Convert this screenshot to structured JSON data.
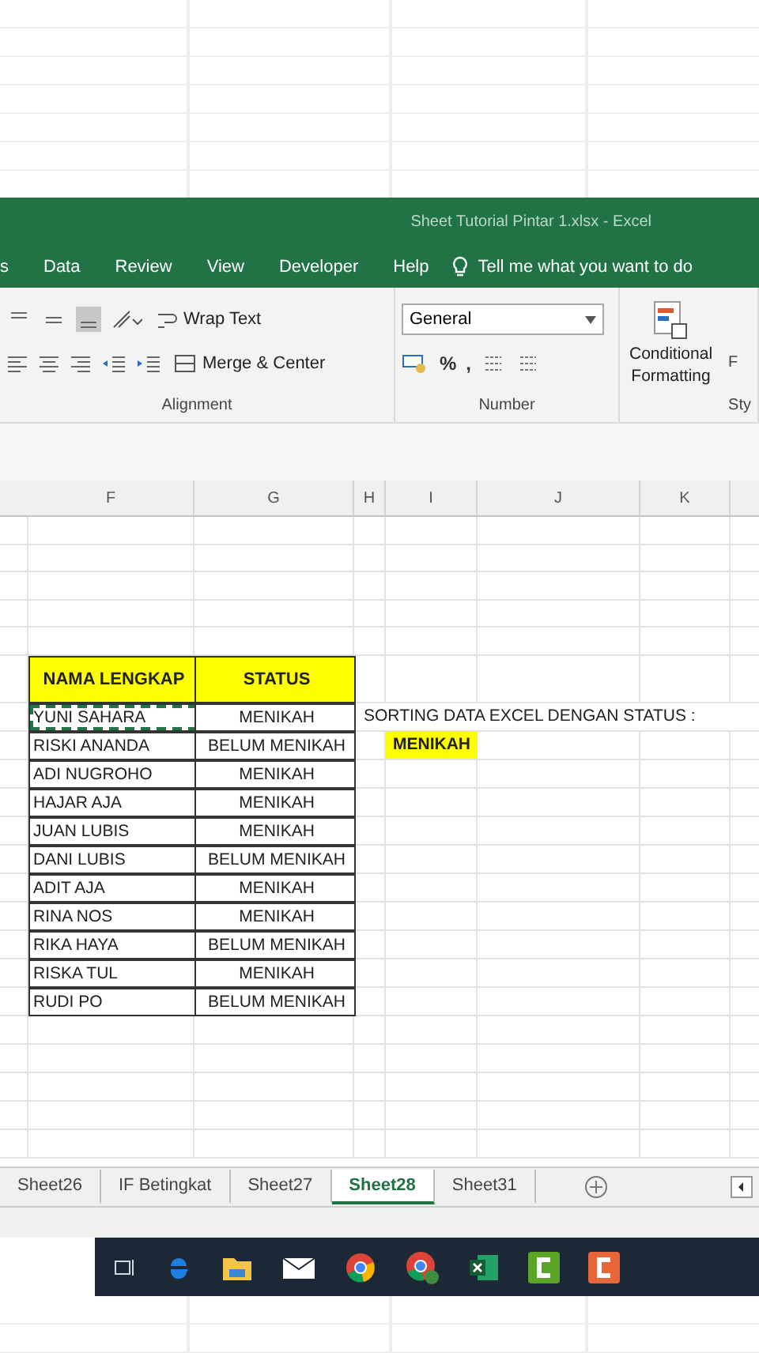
{
  "window": {
    "title": "Sheet Tutorial Pintar 1.xlsx  -  Excel"
  },
  "ribbon_tabs": [
    {
      "label": "s"
    },
    {
      "label": "Data"
    },
    {
      "label": "Review"
    },
    {
      "label": "View"
    },
    {
      "label": "Developer"
    },
    {
      "label": "Help"
    }
  ],
  "tell_me": "Tell me what you want to do",
  "ribbon": {
    "wrap_text": "Wrap Text",
    "merge": "Merge & Center",
    "alignment_label": "Alignment",
    "number_format": "General",
    "percent": "%",
    "comma": ",",
    "number_label": "Number",
    "conditional": [
      "Conditional",
      "Formatting"
    ],
    "next_button_cut": "F",
    "styles_label_cut": "Sty"
  },
  "columns": [
    "F",
    "G",
    "H",
    "I",
    "J",
    "K"
  ],
  "table": {
    "header": [
      "NAMA LENGKAP",
      "STATUS"
    ],
    "rows": [
      {
        "name": "YUNI SAHARA",
        "status": "MENIKAH",
        "copied": true
      },
      {
        "name": "RISKI ANANDA",
        "status": "BELUM MENIKAH",
        "copied": false
      },
      {
        "name": "ADI NUGROHO",
        "status": "MENIKAH",
        "copied": false
      },
      {
        "name": "HAJAR AJA",
        "status": "MENIKAH",
        "copied": false
      },
      {
        "name": "JUAN LUBIS",
        "status": "MENIKAH",
        "copied": false
      },
      {
        "name": "DANI LUBIS",
        "status": "BELUM MENIKAH",
        "copied": false
      },
      {
        "name": "ADIT AJA",
        "status": "MENIKAH",
        "copied": false
      },
      {
        "name": "RINA NOS",
        "status": "MENIKAH",
        "copied": false
      },
      {
        "name": "RIKA HAYA",
        "status": "BELUM MENIKAH",
        "copied": false
      },
      {
        "name": "RISKA TUL",
        "status": "MENIKAH",
        "copied": false
      },
      {
        "name": "RUDI PO",
        "status": "BELUM MENIKAH",
        "copied": false
      }
    ]
  },
  "note": {
    "text": "SORTING DATA EXCEL DENGAN STATUS :",
    "value": "MENIKAH"
  },
  "sheet_tabs": [
    {
      "label": "Sheet26",
      "selected": false
    },
    {
      "label": "IF Betingkat",
      "selected": false
    },
    {
      "label": "Sheet27",
      "selected": false
    },
    {
      "label": "Sheet28",
      "selected": true
    },
    {
      "label": "Sheet31",
      "selected": false
    }
  ]
}
